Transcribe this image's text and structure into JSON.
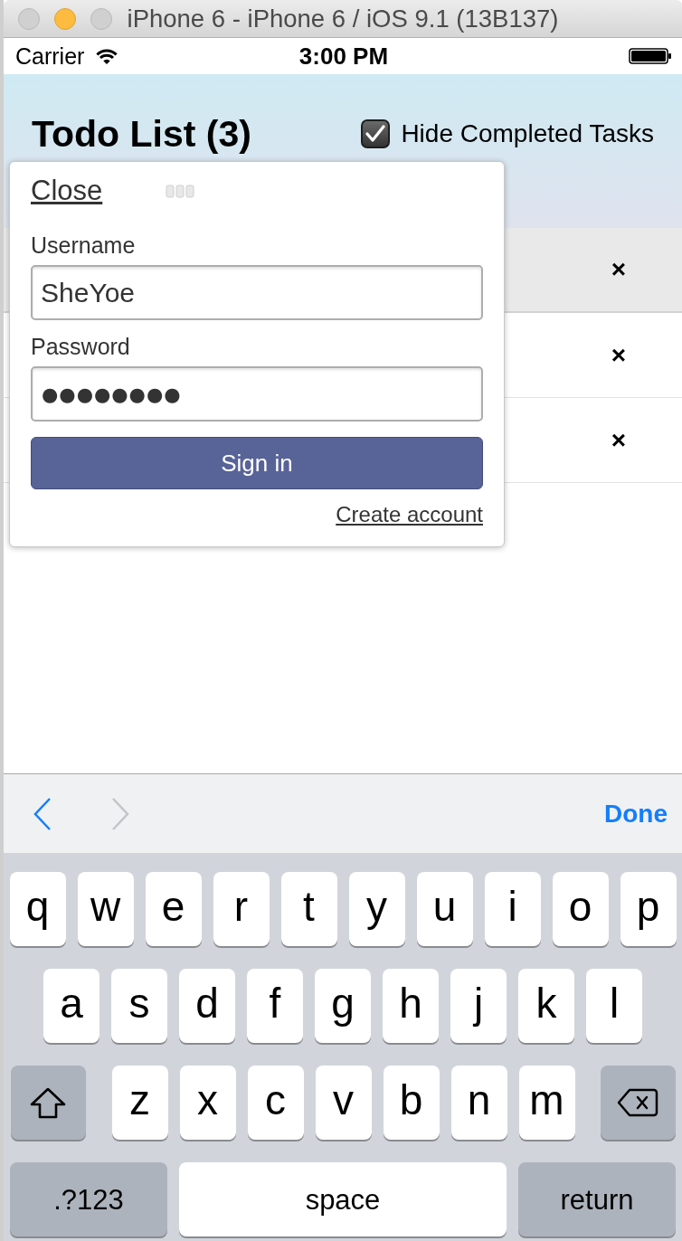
{
  "window": {
    "title": "iPhone 6 - iPhone 6 / iOS 9.1 (13B137)",
    "buttons": [
      {
        "kind": "close",
        "disabled": true
      },
      {
        "kind": "minimize",
        "disabled": false
      },
      {
        "kind": "zoom",
        "disabled": true
      }
    ]
  },
  "status_bar": {
    "carrier": "Carrier",
    "time": "3:00 PM"
  },
  "header": {
    "title": "Todo List (3)",
    "hide_completed": {
      "label": "Hide Completed Tasks",
      "checked": true
    }
  },
  "todo_rows": [
    {
      "delete": "×",
      "selected": true
    },
    {
      "delete": "×",
      "selected": false
    },
    {
      "delete": "×",
      "selected": false
    }
  ],
  "login_popup": {
    "close": "Close",
    "fields": [
      {
        "kind": "text",
        "label": "Username",
        "value": "SheYoe"
      },
      {
        "kind": "password",
        "label": "Password",
        "value": "●●●●●●●●"
      }
    ],
    "submit": "Sign in",
    "create_account": "Create account"
  },
  "keyboard_toolbar": {
    "previous": {
      "disabled": false
    },
    "next": {
      "disabled": true
    },
    "done": "Done"
  },
  "keyboard": {
    "rows": [
      {
        "keys": [
          {
            "kind": "letter",
            "label": "q"
          },
          {
            "kind": "letter",
            "label": "w"
          },
          {
            "kind": "letter",
            "label": "e"
          },
          {
            "kind": "letter",
            "label": "r"
          },
          {
            "kind": "letter",
            "label": "t"
          },
          {
            "kind": "letter",
            "label": "y"
          },
          {
            "kind": "letter",
            "label": "u"
          },
          {
            "kind": "letter",
            "label": "i"
          },
          {
            "kind": "letter",
            "label": "o"
          },
          {
            "kind": "letter",
            "label": "p"
          }
        ]
      },
      {
        "keys": [
          {
            "kind": "letter",
            "label": "a"
          },
          {
            "kind": "letter",
            "label": "s"
          },
          {
            "kind": "letter",
            "label": "d"
          },
          {
            "kind": "letter",
            "label": "f"
          },
          {
            "kind": "letter",
            "label": "g"
          },
          {
            "kind": "letter",
            "label": "h"
          },
          {
            "kind": "letter",
            "label": "j"
          },
          {
            "kind": "letter",
            "label": "k"
          },
          {
            "kind": "letter",
            "label": "l"
          }
        ]
      },
      {
        "keys": [
          {
            "kind": "shift"
          },
          {
            "kind": "letter",
            "label": "z"
          },
          {
            "kind": "letter",
            "label": "x"
          },
          {
            "kind": "letter",
            "label": "c"
          },
          {
            "kind": "letter",
            "label": "v"
          },
          {
            "kind": "letter",
            "label": "b"
          },
          {
            "kind": "letter",
            "label": "n"
          },
          {
            "kind": "letter",
            "label": "m"
          },
          {
            "kind": "delete"
          }
        ]
      },
      {
        "keys": [
          {
            "kind": "mode",
            "label": ".?123"
          },
          {
            "kind": "space",
            "label": "space"
          },
          {
            "kind": "return",
            "label": "return"
          }
        ]
      }
    ]
  }
}
